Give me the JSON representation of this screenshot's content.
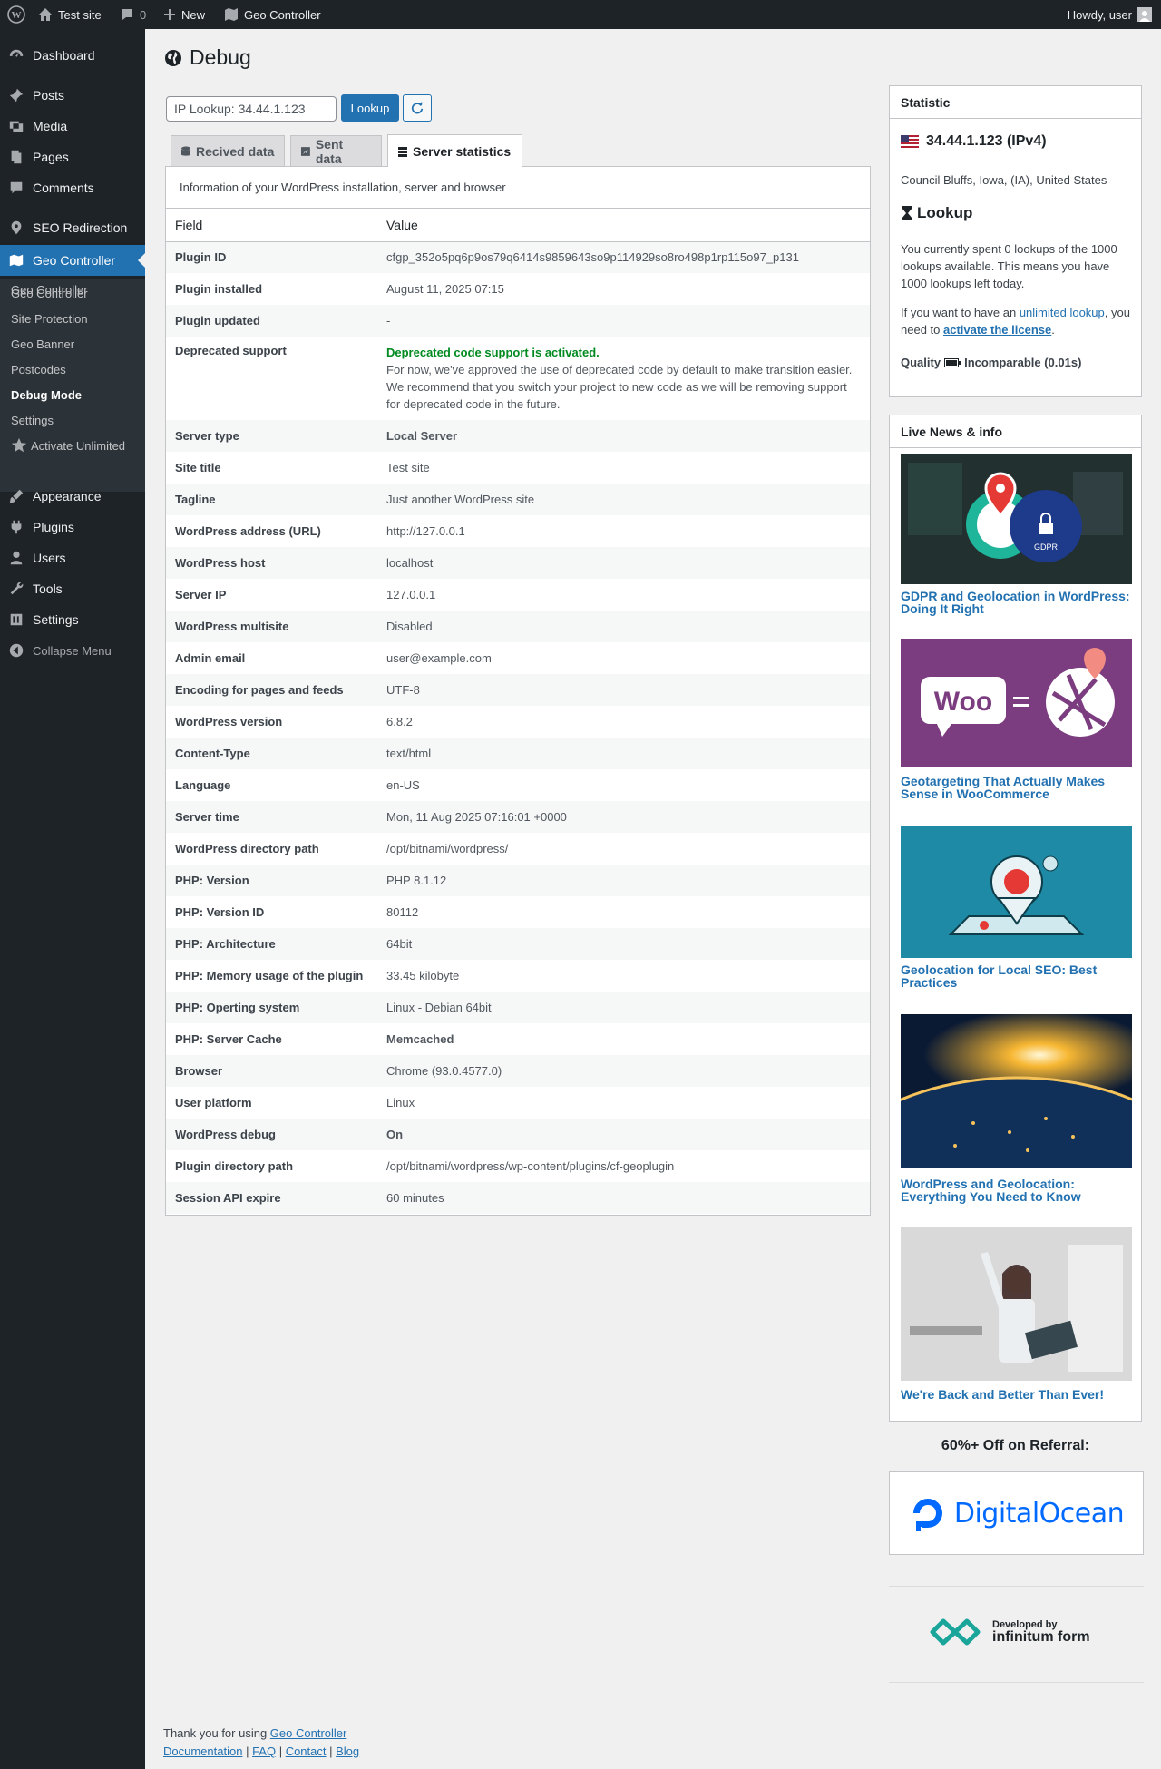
{
  "adminbar": {
    "site": "Test site",
    "comments_count": "0",
    "new_label": "New",
    "plugin": "Geo Controller",
    "howdy": "Howdy, user"
  },
  "sidebar": {
    "items": [
      {
        "label": "Dashboard",
        "icon": "dashboard-icon"
      },
      {
        "label": "Posts",
        "icon": "pin-icon"
      },
      {
        "label": "Media",
        "icon": "media-icon"
      },
      {
        "label": "Pages",
        "icon": "pages-icon"
      },
      {
        "label": "Comments",
        "icon": "comment-icon"
      },
      {
        "label": "SEO Redirection",
        "icon": "location-icon"
      },
      {
        "label": "Geo Controller",
        "icon": "map-icon"
      },
      {
        "label": "Appearance",
        "icon": "brush-icon"
      },
      {
        "label": "Plugins",
        "icon": "plugin-icon"
      },
      {
        "label": "Users",
        "icon": "user-icon"
      },
      {
        "label": "Tools",
        "icon": "wrench-icon"
      },
      {
        "label": "Settings",
        "icon": "settings-icon"
      }
    ],
    "submenu": [
      "Geo Controller",
      "Site Protection",
      "Geo Banner",
      "Postcodes",
      "Debug Mode",
      "Settings",
      "Activate Unlimited"
    ],
    "collapse": "Collapse Menu"
  },
  "page": {
    "title": "Debug",
    "lookup_value": "IP Lookup: 34.44.1.123",
    "lookup_button": "Lookup",
    "tabs": [
      "Recived data",
      "Sent data",
      "Server statistics"
    ],
    "info": "Information of your WordPress installation, server and browser",
    "col_field": "Field",
    "col_value": "Value"
  },
  "rows": [
    {
      "field": "Plugin ID",
      "value": "cfgp_352o5pq6p9os79q6414s9859643so9p114929so8ro498p1rp115o97_p131"
    },
    {
      "field": "Plugin installed",
      "value": "August 11, 2025 07:15"
    },
    {
      "field": "Plugin updated",
      "value": "-"
    },
    {
      "field": "Deprecated support",
      "value": "Deprecated code support is activated.",
      "note": "For now, we've approved the use of deprecated code by default to make transition easier. We recommend that you switch your project to new code as we will be removing support for deprecated code in the future."
    },
    {
      "field": "Server type",
      "value": "Local Server"
    },
    {
      "field": "Site title",
      "value": "Test site"
    },
    {
      "field": "Tagline",
      "value": "Just another WordPress site"
    },
    {
      "field": "WordPress address (URL)",
      "value": "http://127.0.0.1"
    },
    {
      "field": "WordPress host",
      "value": "localhost"
    },
    {
      "field": "Server IP",
      "value": "127.0.0.1"
    },
    {
      "field": "WordPress multisite",
      "value": "Disabled"
    },
    {
      "field": "Admin email",
      "value": "user@example.com"
    },
    {
      "field": "Encoding for pages and feeds",
      "value": "UTF-8"
    },
    {
      "field": "WordPress version",
      "value": "6.8.2"
    },
    {
      "field": "Content-Type",
      "value": "text/html"
    },
    {
      "field": "Language",
      "value": "en-US"
    },
    {
      "field": "Server time",
      "value": "Mon, 11 Aug 2025 07:16:01 +0000"
    },
    {
      "field": "WordPress directory path",
      "value": "/opt/bitnami/wordpress/"
    },
    {
      "field": "PHP: Version",
      "value": "PHP 8.1.12"
    },
    {
      "field": "PHP: Version ID",
      "value": "80112"
    },
    {
      "field": "PHP: Architecture",
      "value": "64bit"
    },
    {
      "field": "PHP: Memory usage of the plugin",
      "value": "33.45 kilobyte"
    },
    {
      "field": "PHP: Operting system",
      "value": "Linux - Debian 64bit"
    },
    {
      "field": "PHP: Server Cache",
      "value": "Memcached"
    },
    {
      "field": "Browser",
      "value": "Chrome (93.0.4577.0)"
    },
    {
      "field": "User platform",
      "value": "Linux"
    },
    {
      "field": "WordPress debug",
      "value": "On"
    },
    {
      "field": "Plugin directory path",
      "value": "/opt/bitnami/wordpress/wp-content/plugins/cf-geoplugin"
    },
    {
      "field": "Session API expire",
      "value": "60 minutes"
    }
  ],
  "statistic": {
    "header": "Statistic",
    "ip": "34.44.1.123 (IPv4)",
    "location": "Council Bluffs, Iowa, (IA), United States",
    "lookup_title": "Lookup",
    "lookup_text": "You currently spent 0 lookups of the 1000 lookups available. This means you have 1000 lookups left today.",
    "license_pre": "If you want to have an ",
    "license_link": "unlimited lookup",
    "license_mid": ", you need to ",
    "license_link2": "activate the license",
    "license_end": ".",
    "quality_label": "Quality",
    "quality_value": "Incomparable (0.01s)"
  },
  "news": {
    "header": "Live News & info",
    "items": [
      "GDPR and Geolocation in WordPress: Doing It Right",
      "Geotargeting That Actually Makes Sense in WooCommerce",
      "Geolocation for Local SEO: Best Practices",
      "WordPress and Geolocation: Everything You Need to Know",
      "We're Back and Better Than Ever!"
    ]
  },
  "promo": {
    "title": "60%+ Off on Referral:",
    "brand": "DigitalOcean"
  },
  "developer": {
    "small": "Developed by",
    "big": "infinitum form"
  },
  "footer": {
    "thanks": "Thank you for using ",
    "plugin_link": "Geo Controller",
    "links": [
      "Documentation",
      "FAQ",
      "Contact",
      "Blog"
    ]
  },
  "colors": {
    "sidebar": "#1d2327",
    "accent": "#2271b1",
    "green": "#008a20",
    "red": "#d63638"
  }
}
